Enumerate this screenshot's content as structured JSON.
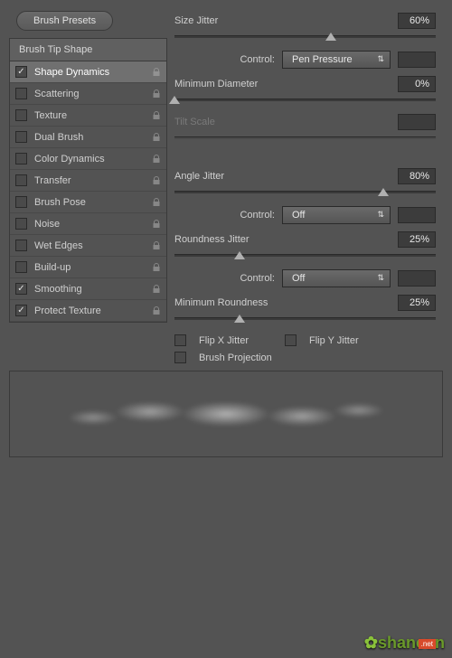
{
  "brushPresetsBtn": "Brush Presets",
  "listHeader": "Brush Tip Shape",
  "items": [
    {
      "label": "Shape Dynamics",
      "checked": true,
      "selected": true,
      "lock": true
    },
    {
      "label": "Scattering",
      "checked": false,
      "lock": true
    },
    {
      "label": "Texture",
      "checked": false,
      "lock": true
    },
    {
      "label": "Dual Brush",
      "checked": false,
      "lock": true
    },
    {
      "label": "Color Dynamics",
      "checked": false,
      "lock": true
    },
    {
      "label": "Transfer",
      "checked": false,
      "lock": true
    },
    {
      "label": "Brush Pose",
      "checked": false,
      "lock": true
    },
    {
      "label": "Noise",
      "checked": false,
      "lock": true
    },
    {
      "label": "Wet Edges",
      "checked": false,
      "lock": true
    },
    {
      "label": "Build-up",
      "checked": false,
      "lock": true
    },
    {
      "label": "Smoothing",
      "checked": true,
      "lock": true
    },
    {
      "label": "Protect Texture",
      "checked": true,
      "lock": true
    }
  ],
  "sizeJitter": {
    "label": "Size Jitter",
    "value": "60%",
    "pos": 60
  },
  "control1": {
    "label": "Control:",
    "value": "Pen Pressure"
  },
  "minDiameter": {
    "label": "Minimum Diameter",
    "value": "0%",
    "pos": 0
  },
  "tiltScale": {
    "label": "Tilt Scale"
  },
  "angleJitter": {
    "label": "Angle Jitter",
    "value": "80%",
    "pos": 80
  },
  "control2": {
    "label": "Control:",
    "value": "Off"
  },
  "roundnessJitter": {
    "label": "Roundness Jitter",
    "value": "25%",
    "pos": 25
  },
  "control3": {
    "label": "Control:",
    "value": "Off"
  },
  "minRoundness": {
    "label": "Minimum Roundness",
    "value": "25%",
    "pos": 25
  },
  "flipX": {
    "label": "Flip X Jitter",
    "checked": false
  },
  "flipY": {
    "label": "Flip Y Jitter",
    "checked": false
  },
  "brushProjection": {
    "label": "Brush Projection",
    "checked": false
  },
  "watermark": "shancun"
}
